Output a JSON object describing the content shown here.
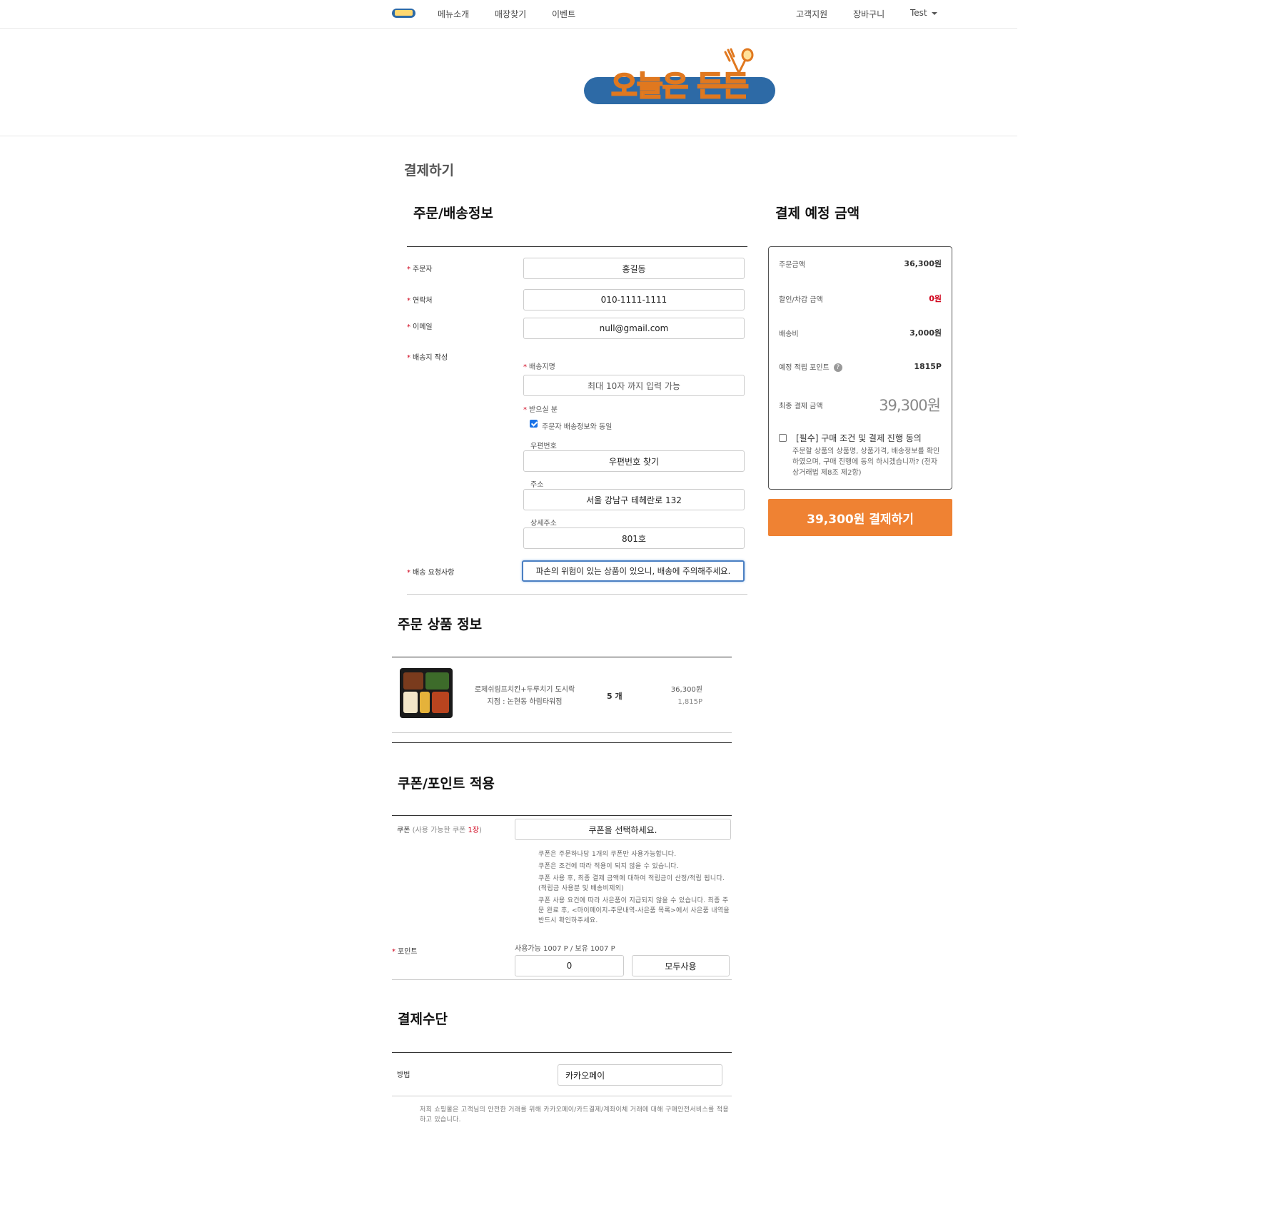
{
  "nav": {
    "left_links": [
      "메뉴소개",
      "매장찾기",
      "이벤트"
    ],
    "right_links": [
      "고객지원",
      "장바구니"
    ],
    "user": "Test"
  },
  "banner": {
    "logo_text": "오늘은 든든"
  },
  "page_title": "결제하기",
  "order_info": {
    "title": "주문/배송정보",
    "orderer_label": "주문자",
    "orderer_value": "홍길동",
    "phone_label": "연락처",
    "phone_value": "010-1111-1111",
    "email_label": "이메일",
    "email_value": "null@gmail.com",
    "address_section_label": "배송지 작성",
    "address_name_label": "배송지명",
    "address_name_placeholder": "최대 10자 까지 입력 가능",
    "recipient_label": "받으실 분",
    "same_as_orderer_label": "주문자 배송정보와 동일",
    "same_as_orderer_checked": true,
    "zipcode_label": "우편번호",
    "zipcode_button": "우편번호 찾기",
    "address_label": "주소",
    "address_value": "서울 강남구 테헤란로 132",
    "detail_address_label": "상세주소",
    "detail_address_value": "801호",
    "request_label": "배송 요청사항",
    "request_value": "파손의 위험이 있는 상품이 있으니, 배송에 주의해주세요."
  },
  "summary": {
    "title": "결제 예정 금액",
    "order_amount_label": "주문금액",
    "order_amount_value": "36,300원",
    "discount_label": "할인/차감 금액",
    "discount_value": "0원",
    "shipping_label": "배송비",
    "shipping_value": "3,000원",
    "points_label": "예정 적립 포인트",
    "points_help": "?",
    "points_value": "1815P",
    "final_label": "최종 결제 금액",
    "final_value": "39,300원",
    "agree_title": "[필수] 구매 조건 및 결제 진행 동의",
    "agree_desc": "주문할 상품의 상품명, 상품가격, 배송정보를 확인하였으며, 구매 진행에 동의 하시겠습니까? (전자상거래법 제8조 제2항)",
    "agree_checked": false,
    "pay_button": "39,300원 결제하기"
  },
  "product_info": {
    "title": "주문 상품 정보",
    "items": [
      {
        "name": "로제쉬림프치킨+두루치기 도시락",
        "branch": "지점 : 논현동 하림타워점",
        "qty": "5 개",
        "price": "36,300원",
        "points": "1,815P"
      }
    ]
  },
  "coupon": {
    "title": "쿠폰/포인트 적용",
    "label": "쿠폰",
    "label_note_prefix": "(사용 가능한 쿠폰 ",
    "label_count": "1장",
    "label_note_suffix": ")",
    "select_label": "쿠폰을 선택하세요.",
    "notices": [
      "쿠폰은 주문하나당 1개의 쿠폰만 사용가능합니다.",
      "쿠폰은 조건에 따라 적용이 되지 않을 수 있습니다.",
      "쿠폰 사용 후, 최종 결제 금액에 대하여 적립금이 산정/적립 됩니다. (적립금 사용분 및 배송비제외)",
      "쿠폰 사용 요건에 따라 사은품이 지급되지 않을 수 있습니다. 최종 주문 완료 후, <마이페이지-주문내역-사은품 목록>에서 사은품 내역을 반드시 확인하주세요."
    ],
    "points_label": "포인트",
    "points_available": "사용가능 1007 P  /  보유 1007 P",
    "points_input_value": "0",
    "use_all_button": "모두사용"
  },
  "payment_method": {
    "title": "결제수단",
    "method_label": "방법",
    "method_value": "카카오페이",
    "footnote": "저희 쇼핑몰은 고객님의 안전한 거래를 위해 카카오페이/카드결제/계좌이체 거래에 대해 구매안전서비스를 적용하고 있습니다."
  },
  "colors": {
    "accent_orange": "#ef8233",
    "required_red": "#d0021b",
    "logo_blue": "#2d6aa6",
    "logo_yellow": "#ffe19a"
  }
}
